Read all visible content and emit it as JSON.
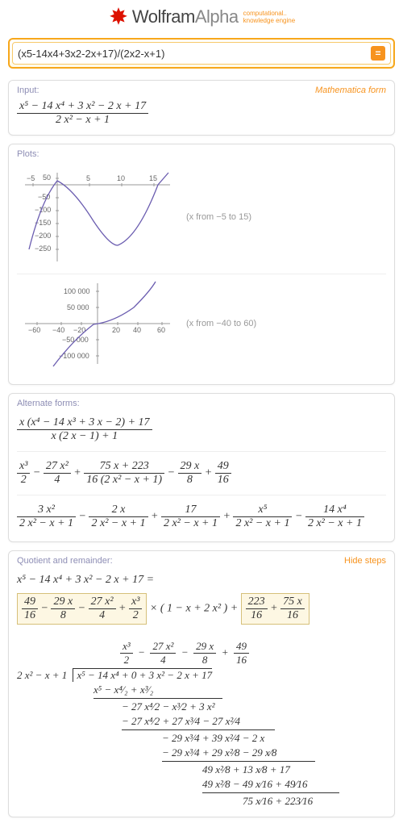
{
  "header": {
    "brand_a": "Wolfram",
    "brand_b": "Alpha",
    "tagline1": "computational..",
    "tagline2": "knowledge engine",
    "submit_glyph": "="
  },
  "query": "(x5-14x4+3x2-2x+17)/(2x2-x+1)",
  "pods": {
    "input": {
      "title": "Input:",
      "link": "Mathematica form"
    },
    "plots": {
      "title": "Plots:",
      "note1": "(x from −5 to 15)",
      "note2": "(x from −40 to 60)"
    },
    "altforms": {
      "title": "Alternate forms:"
    },
    "quotrem": {
      "title": "Quotient and remainder:",
      "link": "Hide steps"
    }
  },
  "math": {
    "input_num": "x⁵ − 14 x⁴ + 3 x² − 2 x + 17",
    "input_den": "2 x² − x + 1",
    "alt1_num": "x (x⁴ − 14 x³ + 3 x − 2) + 17",
    "alt1_den": "x (2 x − 1) + 1",
    "alt2": {
      "t1n": "x³",
      "t1d": "2",
      "t2n": "27 x²",
      "t2d": "4",
      "t3n": "75 x + 223",
      "t3d": "16 (2 x² − x + 1)",
      "t4n": "29 x",
      "t4d": "8",
      "t5n": "49",
      "t5d": "16",
      "minus": "−",
      "plus": "+"
    },
    "alt3": {
      "t1n": "3 x²",
      "t1d": "2 x² − x + 1",
      "t2n": "2 x",
      "t2d": "2 x² − x + 1",
      "t3n": "17",
      "t3d": "2 x² − x + 1",
      "t4n": "x⁵",
      "t4d": "2 x² − x + 1",
      "t5n": "14 x⁴",
      "t5d": "2 x² − x + 1"
    },
    "qr_lhs": "x⁵ − 14 x⁴ + 3 x² − 2 x + 17 =",
    "qr_box1": {
      "a": "49",
      "ad": "16",
      "b": "29 x",
      "bd": "8",
      "c": "27 x²",
      "cd": "4",
      "d": "x³",
      "dd": "2"
    },
    "qr_mid": "× ( 1 − x + 2 x² ) +",
    "qr_box2": {
      "a": "223",
      "ad": "16",
      "b": "75 x",
      "bd": "16"
    },
    "ld": {
      "divisor": "2 x² − x + 1",
      "quot": [
        "x³",
        "2",
        "−",
        "27 x²",
        "4",
        "−",
        "29 x",
        "8",
        "+",
        "49",
        "16"
      ],
      "r0": "x⁵  −  14 x⁴   +   0  +  3 x²  −  2 x  +  17",
      "r1": "x⁵   −   x⁴⁄₂   +   x³⁄₂",
      "r2": "− 27 x⁴⁄2   −   x³⁄2   +  3 x²",
      "r3": "− 27 x⁴⁄2  +  27 x³⁄4  −  27 x²⁄4",
      "r4": "− 29 x³⁄4  +  39 x²⁄4  −  2 x",
      "r5": "− 29 x³⁄4  +  29 x²⁄8  −  29 x⁄8",
      "r6": "49 x²⁄8  +  13 x⁄8  +  17",
      "r7": "49 x²⁄8  −  49 x⁄16  +  49⁄16",
      "r8": "75 x⁄16  +  223⁄16"
    }
  },
  "chart_data": [
    {
      "type": "line",
      "title": "",
      "xlabel": "",
      "ylabel": "",
      "xlim": [
        -5,
        15
      ],
      "ylim": [
        -260,
        60
      ],
      "yticks": [
        50,
        -50,
        -100,
        -150,
        -200,
        -250
      ],
      "xticks": [
        -5,
        5,
        10,
        15
      ],
      "note": "(x from −5 to 15)",
      "series": [
        {
          "name": "(x^5-14x^4+3x^2-2x+17)/(2x^2-x+1)",
          "x": [
            -5,
            -3,
            -1,
            0,
            1,
            3,
            5,
            7,
            9,
            11,
            13,
            15
          ],
          "y": [
            -211,
            -96,
            -5,
            17,
            2.5,
            -62.5,
            -162,
            -192,
            -155,
            -70,
            36,
            60
          ]
        }
      ]
    },
    {
      "type": "line",
      "title": "",
      "xlabel": "",
      "ylabel": "",
      "xlim": [
        -60,
        60
      ],
      "ylim": [
        -110000,
        110000
      ],
      "yticks": [
        100000,
        50000,
        -50000,
        -100000
      ],
      "xticks": [
        -60,
        -40,
        -20,
        20,
        40,
        60
      ],
      "note": "(x from −40 to 60)",
      "series": [
        {
          "name": "(x^5-14x^4+3x^2-2x+17)/(2x^2-x+1)",
          "x": [
            -40,
            -30,
            -20,
            -10,
            0,
            10,
            20,
            30,
            40,
            50,
            60
          ],
          "y": [
            -105000,
            -35000,
            -7000,
            -1200,
            17,
            -200,
            600,
            8000,
            26000,
            70000,
            139000
          ]
        }
      ]
    }
  ]
}
